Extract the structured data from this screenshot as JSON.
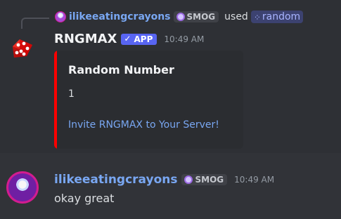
{
  "reply": {
    "username": "ilikeeatingcrayons",
    "tag": "SMOG",
    "used_text": "used",
    "command": "random"
  },
  "bot_message": {
    "author": "RNGMAX",
    "badge": "APP",
    "timestamp": "10:49 AM",
    "embed": {
      "title": "Random Number",
      "value": "1",
      "link_text": "Invite RNGMAX to Your Server!",
      "accent_color": "#ff0000"
    }
  },
  "user_message": {
    "author": "ilikeeatingcrayons",
    "tag": "SMOG",
    "timestamp": "10:49 AM",
    "text": "okay great"
  },
  "colors": {
    "background": "#313338",
    "highlight": "#2e3035",
    "embed_bg": "#2b2d31",
    "link": "#79a7f2",
    "app_badge": "#5865f2"
  },
  "icons": {
    "reply_avatar": "user-avatar-icon",
    "tag_icon": "smog-tag-icon",
    "command_icon": "slash-command-icon",
    "bot_avatar": "red-dice-icon",
    "verified": "checkmark-icon"
  }
}
